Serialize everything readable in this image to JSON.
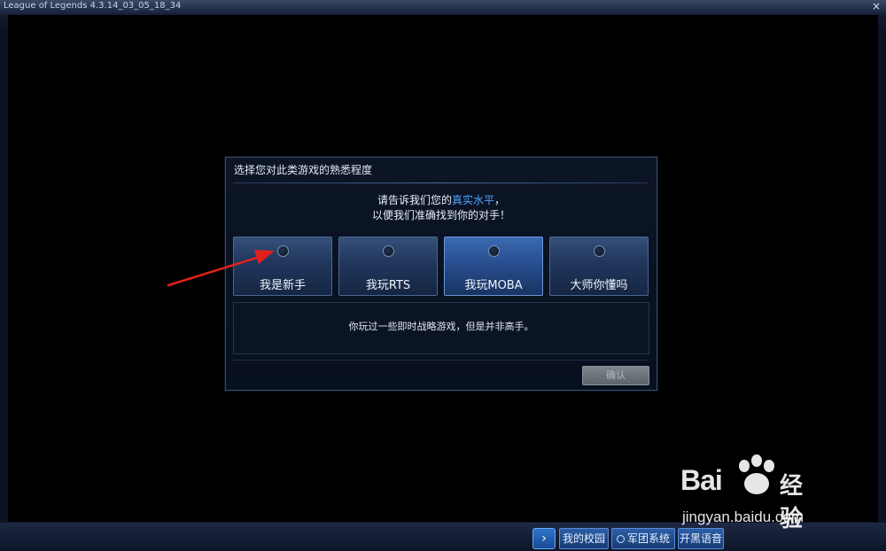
{
  "window": {
    "title": "League of Legends 4.3.14_03_05_18_34",
    "close_label": "×"
  },
  "dialog": {
    "title": "选择您对此类游戏的熟悉程度",
    "prompt_part1": "请告诉我们您的",
    "prompt_highlight": "真实水平",
    "prompt_part2": "，",
    "prompt_line2": "以便我们准确找到你的对手！",
    "options": [
      {
        "label": "我是新手",
        "selected": false
      },
      {
        "label": "我玩RTS",
        "selected": false
      },
      {
        "label": "我玩MOBA",
        "selected": true
      },
      {
        "label": "大师你懂吗",
        "selected": false
      }
    ],
    "description": "你玩过一些即时战略游戏，但是并非高手。",
    "confirm_label": "确认"
  },
  "bottom_bar": {
    "arrow_icon": "chevron-right-icon",
    "buttons": [
      "我的校园",
      "军团系统",
      "开黑语音"
    ]
  },
  "watermark": {
    "brand": "Bai",
    "brand_cn": "经验",
    "url": "jingyan.baidu.com"
  },
  "colors": {
    "highlight": "#4fa3ff",
    "annotation_arrow": "#e0211c"
  }
}
